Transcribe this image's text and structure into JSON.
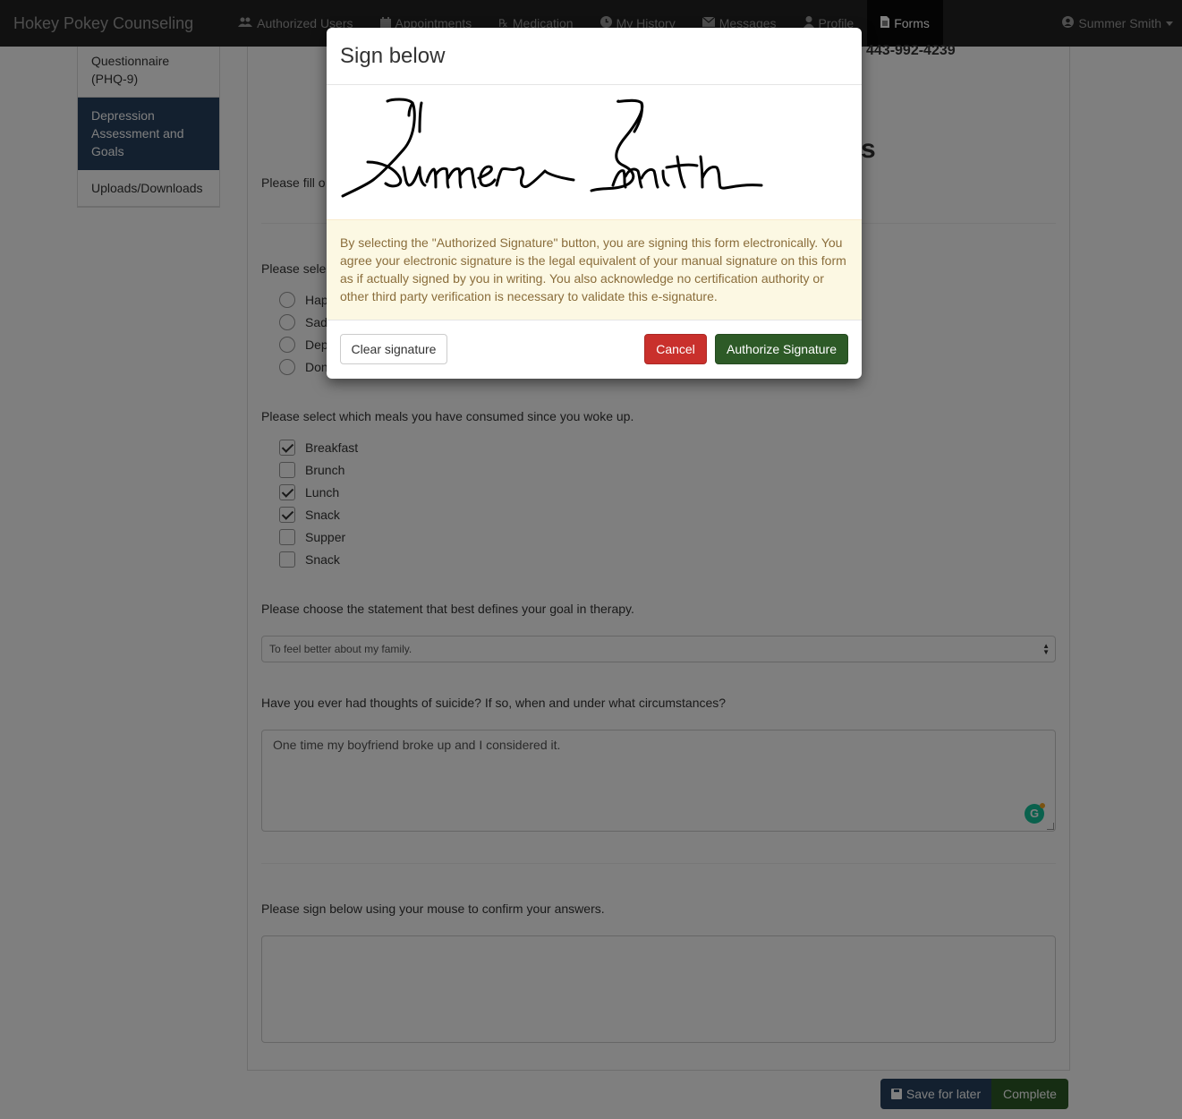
{
  "app": {
    "brand": "Hokey Pokey Counseling"
  },
  "nav": {
    "items": [
      {
        "label": "Authorized Users",
        "icon": "users-icon"
      },
      {
        "label": "Appointments",
        "icon": "calendar-icon"
      },
      {
        "label": "Medication",
        "icon": "prescription-icon"
      },
      {
        "label": "My History",
        "icon": "clock-icon"
      },
      {
        "label": "Messages",
        "icon": "envelope-icon"
      },
      {
        "label": "Profile",
        "icon": "user-icon"
      },
      {
        "label": "Forms",
        "icon": "document-icon",
        "active": true
      }
    ],
    "user": "Summer Smith"
  },
  "sidebar": {
    "items": [
      {
        "label": "Questionnaire (PHQ-9)"
      },
      {
        "label": "Depression Assessment and Goals",
        "active": true
      },
      {
        "label": "Uploads/Downloads"
      }
    ]
  },
  "form": {
    "phone": "443-992-4239",
    "heading_fragment": "s",
    "intro_fragment": "Please fill o",
    "mood_question_fragment": "Please selec",
    "mood_options": [
      "Hap",
      "Sad",
      "Dep",
      "Don"
    ],
    "meals_question": "Please select which meals you have consumed since you woke up.",
    "meals": [
      {
        "label": "Breakfast",
        "checked": true
      },
      {
        "label": "Brunch",
        "checked": false
      },
      {
        "label": "Lunch",
        "checked": true
      },
      {
        "label": "Snack",
        "checked": true
      },
      {
        "label": "Supper",
        "checked": false
      },
      {
        "label": "Snack",
        "checked": false
      }
    ],
    "goal_question": "Please choose the statement that best defines your goal in therapy.",
    "goal_selected": "To feel better about my family.",
    "suicide_question": "Have you ever had thoughts of suicide? If so, when and under what circumstances?",
    "suicide_answer": "One time my boyfriend broke up and I considered it.",
    "sign_prompt": "Please sign below using your mouse to confirm your answers.",
    "save_label": "Save for later",
    "complete_label": "Complete"
  },
  "modal": {
    "title": "Sign below",
    "signature_text": "Summer Smith",
    "notice": "By selecting the \"Authorized Signature\" button, you are signing this form electronically. You agree your electronic signature is the legal equivalent of your manual signature on this form as if actually signed by you in writing. You also acknowledge no certification authority or other third party verification is necessary to validate this e-signature.",
    "clear_label": "Clear signature",
    "cancel_label": "Cancel",
    "authorize_label": "Authorize Signature"
  },
  "colors": {
    "navbar": "#222222",
    "sidebar_active": "#26405e",
    "cancel": "#c9302c",
    "authorize": "#2d5a27",
    "notice_bg": "#fcf8e3"
  }
}
